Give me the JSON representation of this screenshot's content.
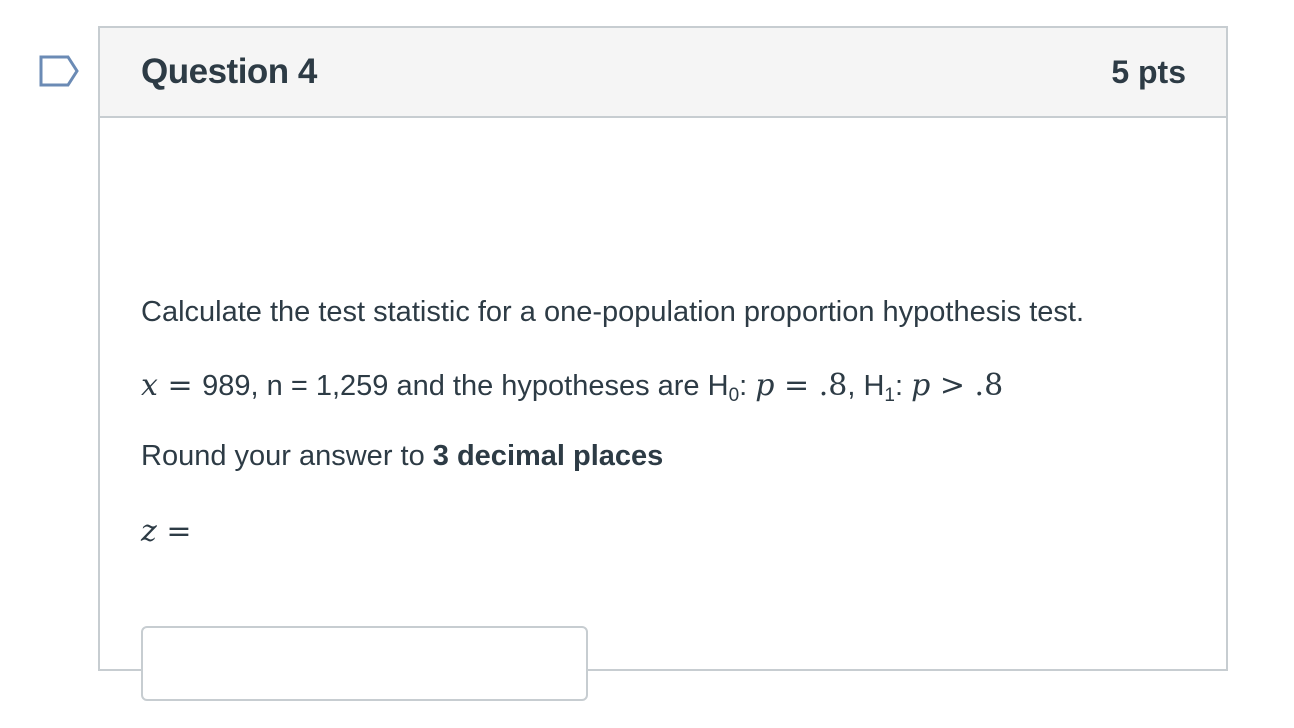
{
  "question": {
    "title": "Question 4",
    "points": "5 pts",
    "prompt": "Calculate the test statistic for a one-population proportion hypothesis test.",
    "given": {
      "x_var": "x",
      "x_equals": " = ",
      "x_value": "989",
      "n_text": ", n = 1,259 and the hypotheses are H",
      "h0_sub": "0",
      "h0_colon": ": ",
      "h0_p": "p",
      "h0_rel": " = ",
      "h0_value": ".8",
      "sep": ", H",
      "h1_sub": "1",
      "h1_colon": ": ",
      "h1_p": "p",
      "h1_rel": " > ",
      "h1_value": ".8"
    },
    "instruction_prefix": "Round your answer to ",
    "instruction_bold": "3 decimal places",
    "answer_var": "z",
    "answer_equals": " ="
  },
  "answer_input": {
    "value": "",
    "placeholder": ""
  },
  "colors": {
    "text": "#2d3b45",
    "border": "#c7cdd1",
    "header_bg": "#f5f5f5",
    "flag_stroke": "#6b8bb5"
  },
  "icons": {
    "flag": "flag-question-icon"
  }
}
